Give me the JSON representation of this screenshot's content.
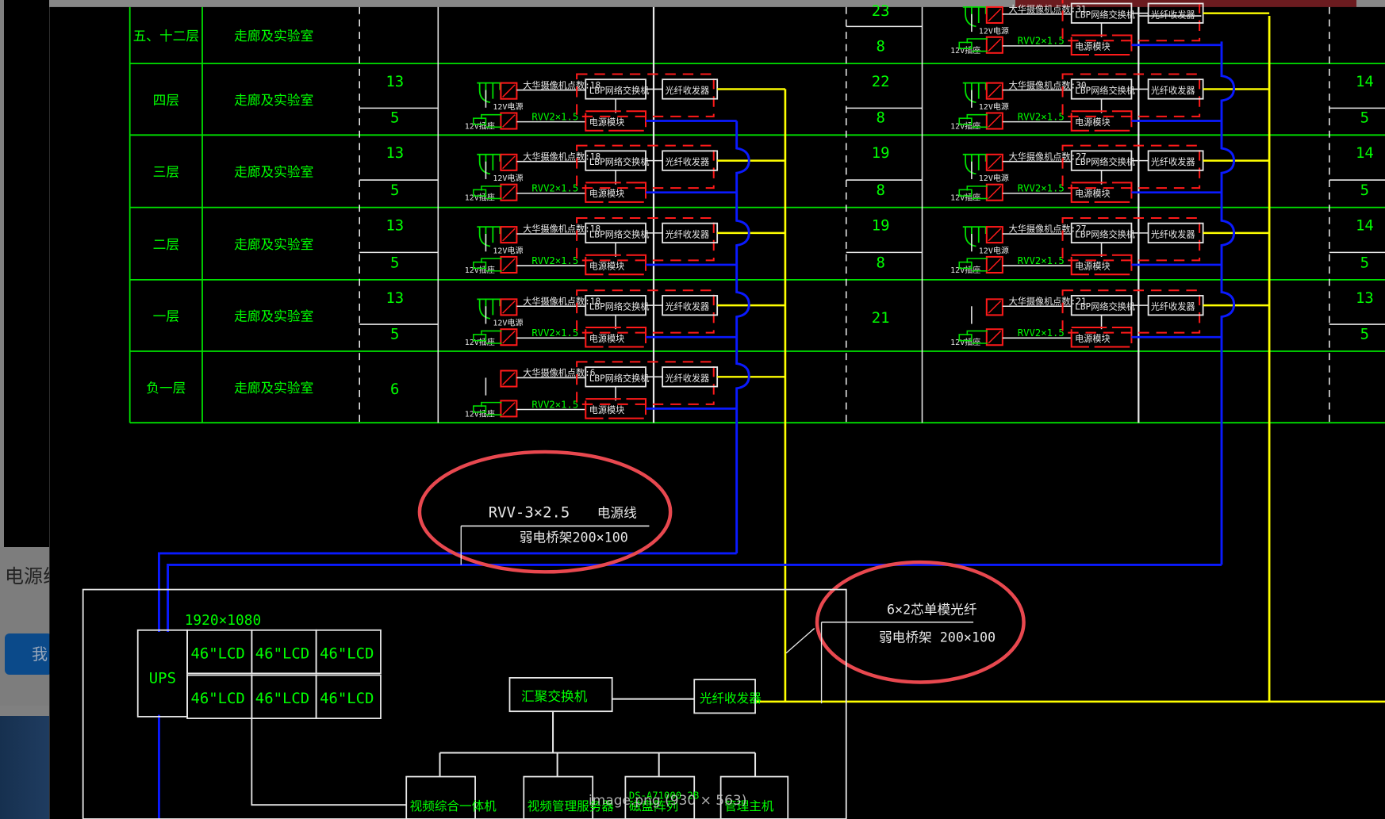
{
  "window": {
    "caption": "image.png (930 × 563)",
    "left_panel_text": "电源线",
    "left_button_label": "我"
  },
  "colors": {
    "background": "#000000",
    "grid_green": "#00e000",
    "text_green": "#00ff00",
    "white_line": "#e8e8e8",
    "red_box": "#ff1a1a",
    "blue_cable": "#0a1aff",
    "yellow_cable": "#ffff00",
    "annotation_ellipse": "#e8484f"
  },
  "table_left": {
    "rows": [
      {
        "floor": "五、十二层",
        "area": "走廊及实验室",
        "counts": []
      },
      {
        "floor": "四层",
        "area": "走廊及实验室",
        "counts": [
          "13",
          "5"
        ]
      },
      {
        "floor": "三层",
        "area": "走廊及实验室",
        "counts": [
          "13",
          "5"
        ]
      },
      {
        "floor": "二层",
        "area": "走廊及实验室",
        "counts": [
          "13",
          "5"
        ]
      },
      {
        "floor": "一层",
        "area": "走廊及实验室",
        "counts": [
          "13",
          "5"
        ]
      },
      {
        "floor": "负一层",
        "area": "走廊及实验室",
        "counts": [
          "6"
        ]
      }
    ]
  },
  "table_middle_counts": [
    [
      "23",
      "8"
    ],
    [
      "22",
      "8"
    ],
    [
      "19",
      "8"
    ],
    [
      "19",
      "8"
    ],
    [
      "21"
    ]
  ],
  "table_right_counts": [
    [
      "14",
      "5"
    ],
    [
      "14",
      "5"
    ],
    [
      "14",
      "5"
    ],
    [
      "13",
      "5"
    ]
  ],
  "left_device_rows": [
    {
      "camera_label": "大华摄像机点数:18",
      "switch": "LBP网络交换机",
      "power_cable": "RVV2×1.5",
      "power_box": "电源模块",
      "fiber": "光纤收发器",
      "kvm": "12V电源",
      "socket": "12V插座"
    },
    {
      "camera_label": "大华摄像机点数:18",
      "switch": "LBP网络交换机",
      "power_cable": "RVV2×1.5",
      "power_box": "电源模块",
      "fiber": "光纤收发器",
      "kvm": "12V电源",
      "socket": "12V插座"
    },
    {
      "camera_label": "大华摄像机点数:18",
      "switch": "LBP网络交换机",
      "power_cable": "RVV2×1.5",
      "power_box": "电源模块",
      "fiber": "光纤收发器",
      "kvm": "12V电源",
      "socket": "12V插座"
    },
    {
      "camera_label": "大华摄像机点数:18",
      "switch": "LBP网络交换机",
      "power_cable": "RVV2×1.5",
      "power_box": "电源模块",
      "fiber": "光纤收发器",
      "kvm": "12V电源",
      "socket": "12V插座"
    },
    {
      "camera_label": "大华摄像机点数:6",
      "switch": "LBP网络交换机",
      "power_cable": "RVV2×1.5",
      "power_box": "电源模块",
      "fiber": "光纤收发器",
      "kvm": "",
      "socket": "12V插座"
    }
  ],
  "right_device_rows": [
    {
      "camera_label": "大华摄像机点数:31",
      "switch": "LBP网络交换机",
      "power_cable": "RVV2×1.5",
      "power_box": "电源模块",
      "fiber": "光纤收发器",
      "kvm": "12V电源",
      "socket": "12V插座"
    },
    {
      "camera_label": "大华摄像机点数:30",
      "switch": "LBP网络交换机",
      "power_cable": "RVV2×1.5",
      "power_box": "电源模块",
      "fiber": "光纤收发器",
      "kvm": "12V电源",
      "socket": "12V插座"
    },
    {
      "camera_label": "大华摄像机点数:27",
      "switch": "LBP网络交换机",
      "power_cable": "RVV2×1.5",
      "power_box": "电源模块",
      "fiber": "光纤收发器",
      "kvm": "12V电源",
      "socket": "12V插座"
    },
    {
      "camera_label": "大华摄像机点数:27",
      "switch": "LBP网络交换机",
      "power_cable": "RVV2×1.5",
      "power_box": "电源模块",
      "fiber": "光纤收发器",
      "kvm": "12V电源",
      "socket": "12V插座"
    },
    {
      "camera_label": "大华摄像机点数:21",
      "switch": "LBP网络交换机",
      "power_cable": "RVV2×1.5",
      "power_box": "电源模块",
      "fiber": "光纤收发器",
      "kvm": "",
      "socket": "12V插座"
    }
  ],
  "annotations": {
    "power_cable": {
      "line1": "RVV-3×2.5",
      "line1_suffix": "电源线",
      "line2": "弱电桥架200×100"
    },
    "fiber_cable": {
      "line1": "6×2芯单模光纤",
      "line2": "弱电桥架 200×100"
    }
  },
  "control_room": {
    "resolution": "1920×1080",
    "ups": "UPS",
    "lcd_label": "46\"LCD",
    "lcd_count": 6,
    "core_switch": "汇聚交换机",
    "fiber_transceiver": "光纤收发器",
    "bottom_devices": [
      "视频综合一体机",
      "视频管理服务器",
      "磁盘阵列",
      "管理主机"
    ],
    "disk_array_sub": "DS-A71000 2B"
  }
}
